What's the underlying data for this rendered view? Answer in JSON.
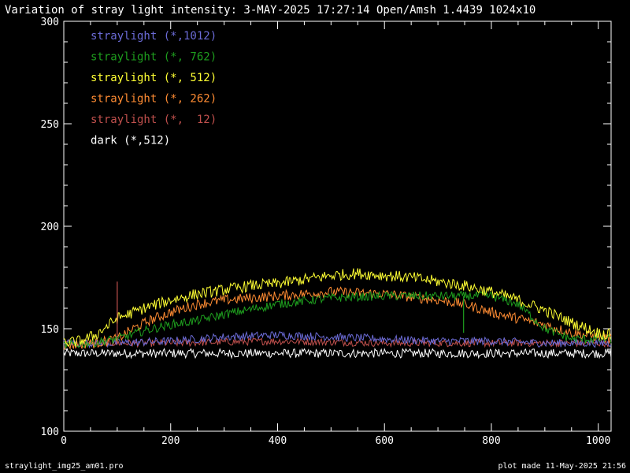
{
  "chart_data": {
    "type": "line",
    "title": "Variation of stray light intensity:  3-MAY-2025 17:27:14   Open/Amsh   1.4439 1024x10",
    "xlabel": "",
    "ylabel": "",
    "xlim": [
      0,
      1024
    ],
    "ylim": [
      100,
      300
    ],
    "x_ticks": [
      "0",
      "200",
      "400",
      "600",
      "800",
      "1000"
    ],
    "y_ticks": [
      "100",
      "150",
      "200",
      "250",
      "300"
    ],
    "grid": false,
    "legend_position": "top-left",
    "series": [
      {
        "name": "straylight (*,1012)",
        "color": "#6b6bd6",
        "x": [
          0,
          100,
          200,
          300,
          400,
          500,
          600,
          700,
          800,
          900,
          1024
        ],
        "y": [
          143,
          143,
          144,
          146,
          147,
          146,
          145,
          144,
          144,
          143,
          143
        ]
      },
      {
        "name": "straylight (*, 762)",
        "color": "#1e9e1e",
        "x": [
          0,
          50,
          100,
          150,
          200,
          250,
          300,
          400,
          500,
          600,
          700,
          800,
          850,
          900,
          950,
          1024
        ],
        "y": [
          142,
          143,
          145,
          149,
          152,
          154,
          157,
          162,
          165,
          166,
          166,
          166,
          162,
          150,
          145,
          145
        ]
      },
      {
        "name": "straylight (*, 512)",
        "color": "#ffff33",
        "x": [
          0,
          30,
          60,
          100,
          150,
          200,
          250,
          300,
          350,
          400,
          450,
          500,
          550,
          600,
          650,
          700,
          750,
          800,
          850,
          900,
          950,
          1000,
          1024
        ],
        "y": [
          143,
          144,
          147,
          155,
          160,
          164,
          167,
          169,
          171,
          172,
          174,
          176,
          177,
          176,
          175,
          173,
          171,
          168,
          164,
          159,
          153,
          148,
          147
        ]
      },
      {
        "name": "straylight (*, 262)",
        "color": "#ff8c33",
        "x": [
          0,
          60,
          100,
          130,
          160,
          200,
          250,
          300,
          400,
          500,
          600,
          700,
          750,
          800,
          850,
          900,
          950,
          1000,
          1024
        ],
        "y": [
          142,
          143,
          145,
          150,
          154,
          158,
          162,
          164,
          166,
          168,
          167,
          164,
          162,
          158,
          155,
          152,
          148,
          146,
          145
        ]
      },
      {
        "name": "straylight (*,  12)",
        "color": "#c0504d",
        "x": [
          0,
          200,
          400,
          600,
          800,
          1024
        ],
        "y": [
          143,
          143,
          144,
          143,
          143,
          143
        ]
      },
      {
        "name": "dark (*,512)",
        "color": "#ffffff",
        "x": [
          0,
          200,
          400,
          600,
          800,
          1024
        ],
        "y": [
          138,
          138,
          138,
          138,
          138,
          138
        ]
      }
    ],
    "annotations": [
      {
        "series": "straylight (*,  12)",
        "x": 100,
        "y": 173
      },
      {
        "series": "straylight (*, 762)",
        "x": 748,
        "y": 148
      }
    ]
  },
  "footer": {
    "left": "straylight_img25_am01.pro",
    "right": "plot made 11-May-2025 21:56"
  }
}
